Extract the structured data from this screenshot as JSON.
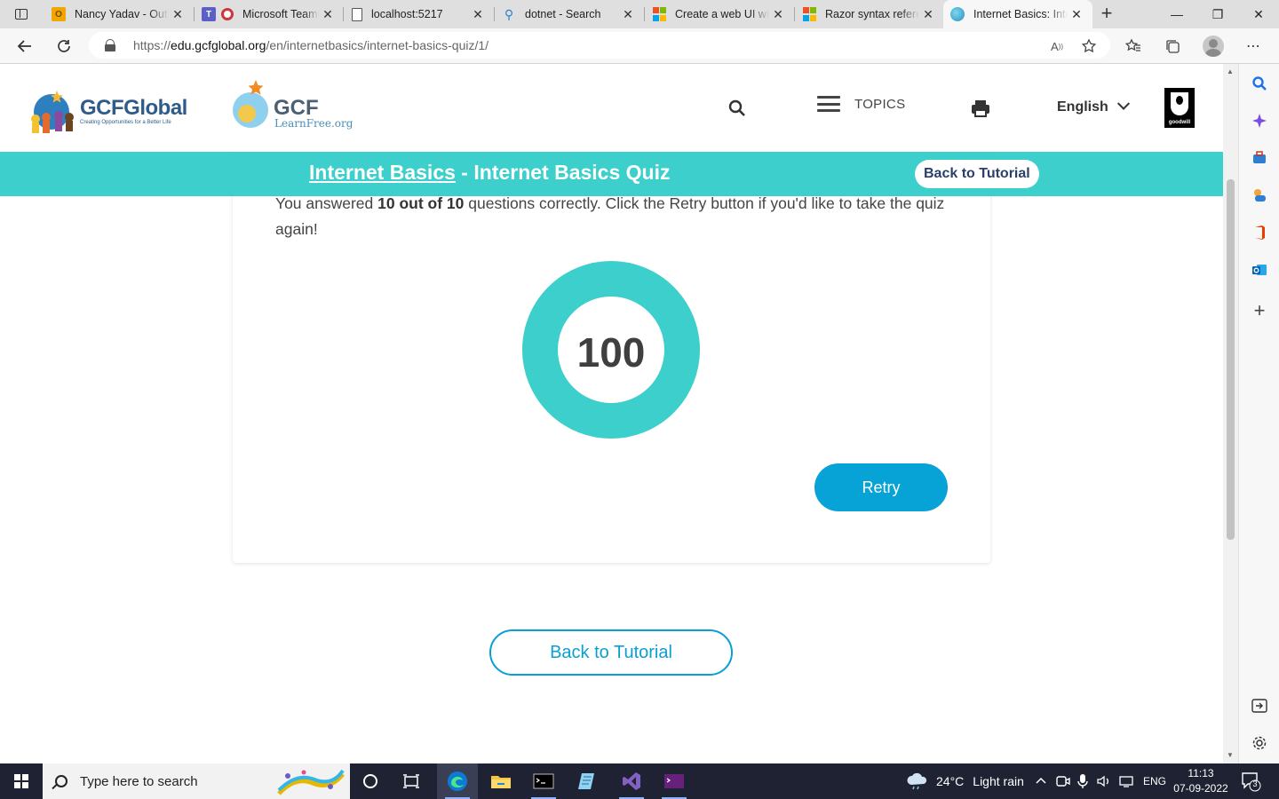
{
  "browser": {
    "tabs": [
      {
        "title": "Nancy Yadav - Outlook",
        "icon": "outlook-icon",
        "color": "#f0a500"
      },
      {
        "title": "Microsoft Teams",
        "icon": "teams-icon",
        "color": "#5b5fc7"
      },
      {
        "title": "localhost:5217",
        "icon": "page-icon",
        "color": "#666666"
      },
      {
        "title": "dotnet - Search",
        "icon": "search-icon",
        "color": "#2d7fd3"
      },
      {
        "title": "Create a web UI with",
        "icon": "microsoft-icon",
        "color": "#f25022"
      },
      {
        "title": "Razor syntax reference",
        "icon": "microsoft-icon",
        "color": "#f25022"
      },
      {
        "title": "Internet Basics: Internet",
        "icon": "gcf-icon",
        "color": "#3ccfcb"
      }
    ],
    "url_scheme": "https://",
    "url_host": "edu.gcfglobal.org",
    "url_path": "/en/internetbasics/internet-basics-quiz/1/"
  },
  "header": {
    "logo_gcfglobal": "GCFGlobal",
    "logo_gcfglobal_tagline": "Creating Opportunities for a Better Life",
    "logo_learnfree_word": "GCF",
    "logo_learnfree_sub": "LearnFree.org",
    "topics_label": "TOPICS",
    "language": "English",
    "goodwill_text": "goodwill"
  },
  "quiz_bar": {
    "course": "Internet Basics",
    "separator": " - ",
    "quiz_title": "Internet Basics Quiz",
    "back_label": "Back to Tutorial"
  },
  "result": {
    "prefix": "You answered ",
    "score_text": "10 out of 10",
    "suffix": " questions correctly. Click the Retry button if you'd like to take the quiz again!",
    "score": "100",
    "score_fraction": 1.0,
    "ring_color": "#3ccfcb",
    "retry_label": "Retry"
  },
  "footer": {
    "back_label": "Back to Tutorial"
  },
  "taskbar": {
    "search_placeholder": "Type here to search",
    "weather_temp": "24°C",
    "weather_desc": "Light rain",
    "lang": "ENG",
    "time": "11:13",
    "date": "07-09-2022",
    "notification_count": "3"
  }
}
